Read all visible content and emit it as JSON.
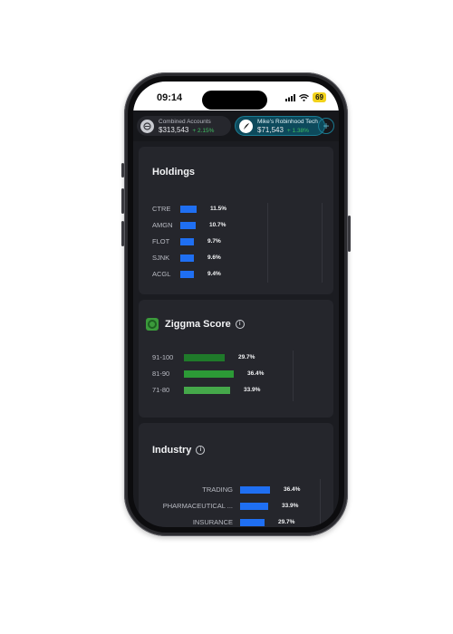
{
  "status_bar": {
    "time": "09:14",
    "battery": "69"
  },
  "accounts": [
    {
      "name": "Combined Accounts",
      "value": "$313,543",
      "change": "+ 2.15%"
    },
    {
      "name": "Mike's Robinhood Tech",
      "value": "$71,543",
      "change": "+ 1.38%"
    }
  ],
  "add_account_label": "+",
  "holdings": {
    "title": "Holdings",
    "items": [
      {
        "label": "CTRE",
        "pct": "11.5%",
        "value": 11.5
      },
      {
        "label": "AMGN",
        "pct": "10.7%",
        "value": 10.7
      },
      {
        "label": "FLOT",
        "pct": "9.7%",
        "value": 9.7
      },
      {
        "label": "SJNK",
        "pct": "9.6%",
        "value": 9.6
      },
      {
        "label": "ACGL",
        "pct": "9.4%",
        "value": 9.4
      }
    ]
  },
  "ziggma": {
    "title": "Ziggma Score",
    "items": [
      {
        "label": "91-100",
        "pct": "29.7%",
        "value": 29.7,
        "color": "#1f7a2a"
      },
      {
        "label": "81-90",
        "pct": "36.4%",
        "value": 36.4,
        "color": "#2c9a36"
      },
      {
        "label": "71-80",
        "pct": "33.9%",
        "value": 33.9,
        "color": "#45a84a"
      }
    ]
  },
  "industry": {
    "title": "Industry",
    "items": [
      {
        "label": "TRADING",
        "pct": "36.4%",
        "value": 36.4
      },
      {
        "label": "PHARMACEUTICAL ...",
        "pct": "33.9%",
        "value": 33.9
      },
      {
        "label": "INSURANCE",
        "pct": "29.7%",
        "value": 29.7
      }
    ]
  },
  "colors": {
    "bar_blue": "#1f6ff2",
    "accent_teal": "#1b7c93",
    "card_bg": "#25262c"
  }
}
